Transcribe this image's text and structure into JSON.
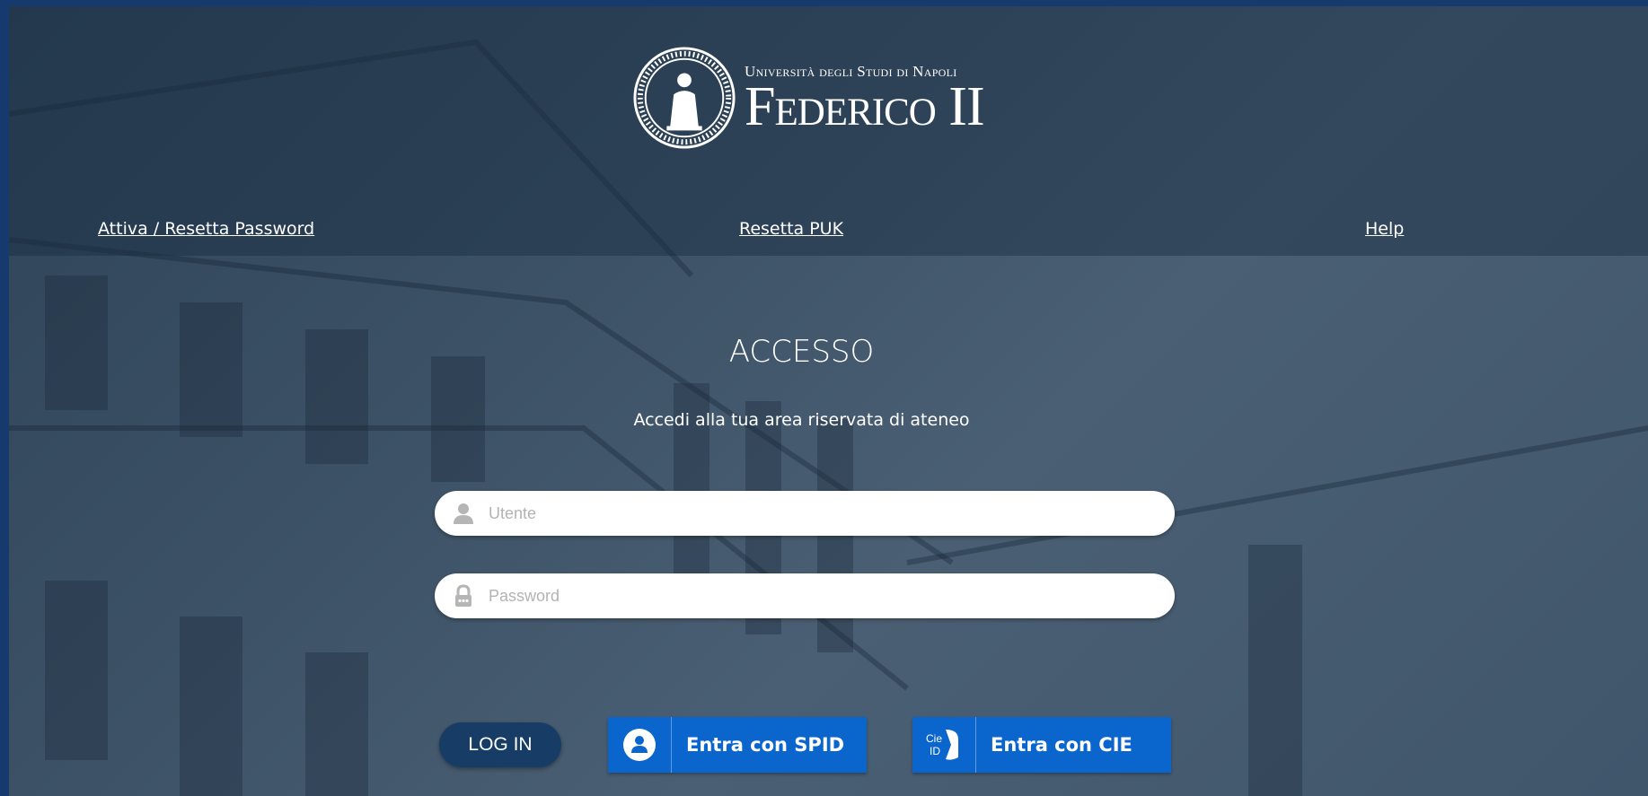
{
  "header": {
    "logo_subtitle": "Università degli Studi di Napoli",
    "logo_title": "Federico II"
  },
  "nav": {
    "activate_reset_password": "Attiva / Resetta Password",
    "reset_puk": "Resetta PUK",
    "help": "Help"
  },
  "main": {
    "title": "ACCESSO",
    "subtitle": "Accedi alla tua area riservata di ateneo"
  },
  "form": {
    "username": {
      "placeholder": "Utente",
      "value": ""
    },
    "password": {
      "placeholder": "Password",
      "value": ""
    },
    "login_label": "LOG IN"
  },
  "sso": {
    "spid_label": "Entra con SPID",
    "cie_label": "Entra con CIE",
    "cie_icon_text": "Cie ID"
  },
  "colors": {
    "page_border": "#173a6e",
    "login_button": "#173d66",
    "sso_button": "#0a66cc"
  },
  "icons": [
    "university-seal-icon",
    "user-icon",
    "lock-icon",
    "spid-user-icon",
    "cie-id-icon"
  ]
}
